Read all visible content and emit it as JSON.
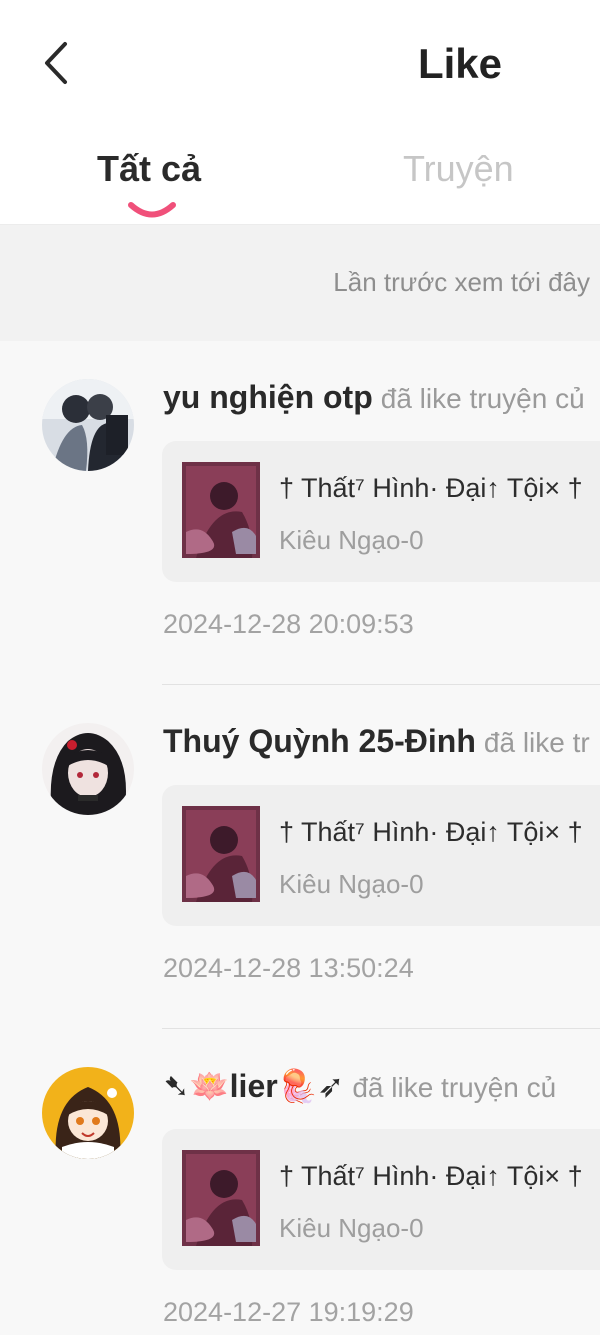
{
  "header": {
    "title": "Like",
    "back_icon": "chevron-left-icon"
  },
  "tabs": [
    {
      "label": "Tất cả",
      "active": true
    },
    {
      "label": "Truyện",
      "active": false
    }
  ],
  "history_marker": "Lần trước xem tới đây",
  "colors": {
    "accent": "#f0507a",
    "inactive_tab": "#c6c6c6"
  },
  "feed": [
    {
      "user_name": "yu nghiện otp",
      "action": "đã like truyện củ",
      "story_title": "† Thất⁷ Hình· Đại↑ Tội× †",
      "story_author": "Kiêu Ngạo-0",
      "timestamp": "2024-12-28 20:09:53"
    },
    {
      "user_name": "Thuý Quỳnh 25-Đinh",
      "action": "đã like tr",
      "story_title": "† Thất⁷ Hình· Đại↑ Tội× †",
      "story_author": "Kiêu Ngạo-0",
      "timestamp": "2024-12-28 13:50:24"
    },
    {
      "user_name": "➷🪷lier🪼➶",
      "action": "đã like truyện củ",
      "story_title": "† Thất⁷ Hình· Đại↑ Tội× †",
      "story_author": "Kiêu Ngạo-0",
      "timestamp": "2024-12-27 19:19:29"
    }
  ]
}
